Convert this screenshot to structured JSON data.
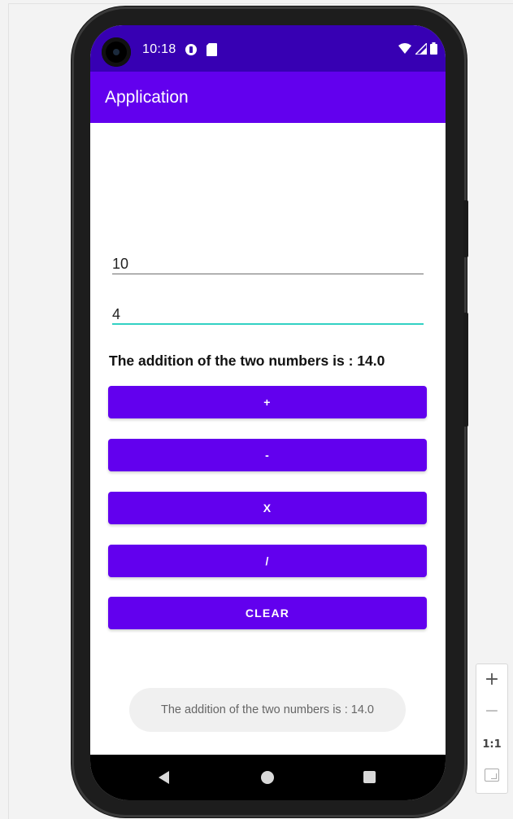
{
  "status_bar": {
    "time": "10:18"
  },
  "app": {
    "title": "Application"
  },
  "inputs": {
    "first_value": "10",
    "second_value": "4"
  },
  "result_text": "The addition of the two numbers is : 14.0",
  "buttons": {
    "add": "+",
    "subtract": "-",
    "multiply": "X",
    "divide": "/",
    "clear": "CLEAR"
  },
  "toast_text": "The addition of the two numbers is : 14.0",
  "zoom": {
    "zoom_in": "+",
    "zoom_out": "−",
    "actual_size": "1:1"
  },
  "colors": {
    "status_bar": "#3700b3",
    "app_bar": "#6200ee",
    "button": "#6200ee",
    "input_focus": "#33d1c4"
  },
  "icons": [
    "camera-icon",
    "notification-icon",
    "sd-card-icon",
    "wifi-icon",
    "signal-icon",
    "battery-icon",
    "back-icon",
    "home-icon",
    "recents-icon",
    "fit-screen-icon"
  ]
}
